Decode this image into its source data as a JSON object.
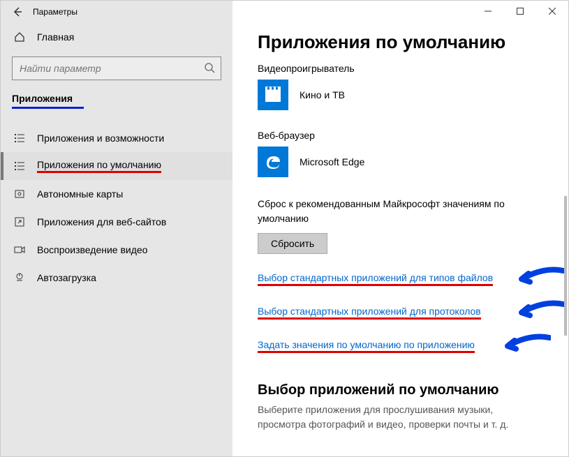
{
  "window": {
    "title": "Параметры"
  },
  "sidebar": {
    "home": "Главная",
    "search_placeholder": "Найти параметр",
    "category": "Приложения",
    "items": [
      {
        "label": "Приложения и возможности"
      },
      {
        "label": "Приложения по умолчанию"
      },
      {
        "label": "Автономные карты"
      },
      {
        "label": "Приложения для веб-сайтов"
      },
      {
        "label": "Воспроизведение видео"
      },
      {
        "label": "Автозагрузка"
      }
    ]
  },
  "main": {
    "title": "Приложения по умолчанию",
    "video_label": "Видеопроигрыватель",
    "video_app": "Кино и ТВ",
    "browser_label": "Веб-браузер",
    "browser_app": "Microsoft Edge",
    "reset_text": "Сброс к рекомендованным Майкрософт значениям по умолчанию",
    "reset_button": "Сбросить",
    "links": [
      "Выбор стандартных приложений для типов файлов",
      "Выбор стандартных приложений для протоколов",
      "Задать значения по умолчанию по приложению"
    ],
    "section2_title": "Выбор приложений по умолчанию",
    "section2_desc": "Выберите приложения для прослушивания музыки, просмотра фотографий и видео, проверки почты и т. д."
  }
}
